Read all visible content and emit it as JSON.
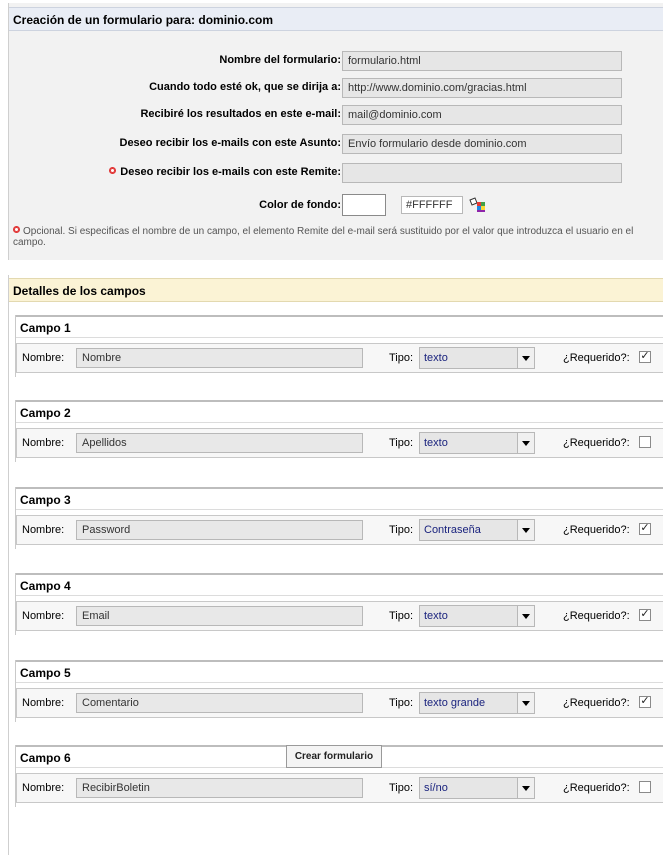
{
  "form": {
    "title": "Creación de un formulario para: dominio.com",
    "rows": [
      {
        "label": "Nombre del formulario:",
        "value": "formulario.html",
        "optional": false
      },
      {
        "label": "Cuando todo esté ok, que se dirija a:",
        "value": "http://www.dominio.com/gracias.html",
        "optional": false
      },
      {
        "label": "Recibiré los resultados en este e-mail:",
        "value": "mail@dominio.com",
        "optional": false
      },
      {
        "label": "Deseo recibir los e-mails con este Asunto:",
        "value": "Envío formulario desde dominio.com",
        "optional": false
      },
      {
        "label": "Deseo recibir los e-mails con este Remite:",
        "value": "",
        "optional": true
      }
    ],
    "bgcolor": {
      "label": "Color de fondo:",
      "hex": "#FFFFFF",
      "swatch": "#ffffff"
    },
    "note": "Opcional. Si especificas el nombre de un campo, el elemento Remite del e-mail será sustituido por el valor que introduzca el usuario en el campo."
  },
  "details": {
    "title": "Detalles de los campos",
    "name_label": "Nombre:",
    "type_label": "Tipo:",
    "required_label": "¿Requerido?:",
    "fields": [
      {
        "title": "Campo 1",
        "name": "Nombre",
        "type": "texto",
        "required": true
      },
      {
        "title": "Campo 2",
        "name": "Apellidos",
        "type": "texto",
        "required": false
      },
      {
        "title": "Campo 3",
        "name": "Password",
        "type": "Contraseña",
        "required": true
      },
      {
        "title": "Campo 4",
        "name": "Email",
        "type": "texto",
        "required": true
      },
      {
        "title": "Campo 5",
        "name": "Comentario",
        "type": "texto grande",
        "required": true
      },
      {
        "title": "Campo 6",
        "name": "RecibirBoletin",
        "type": "sí/no",
        "required": false
      }
    ]
  },
  "submit_label": "Crear formulario",
  "colors": {
    "header_blue": "#e9edf5",
    "header_yellow": "#fbf3d5",
    "panel_gray": "#f2f2f2",
    "select_text": "#1a237e"
  }
}
